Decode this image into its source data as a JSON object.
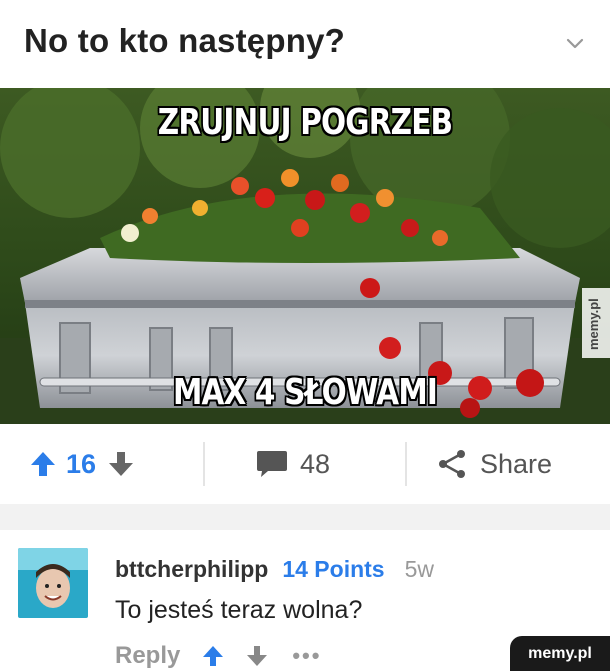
{
  "post": {
    "title": "No to kto następny?"
  },
  "image": {
    "caption_top": "ZRUJNUJ POGRZEB",
    "caption_bottom": "MAX 4 SŁOWAMI",
    "side_watermark": "memy.pl"
  },
  "actions": {
    "upvotes": "16",
    "comments": "48",
    "share_label": "Share"
  },
  "comment": {
    "username": "bttcherphilipp",
    "points": "14 Points",
    "age": "5w",
    "text": "To jesteś teraz wolna?",
    "reply_label": "Reply",
    "more": "•••"
  },
  "footer": {
    "watermark": "memy.pl"
  },
  "colors": {
    "accent": "#2b7de9",
    "muted": "#999999"
  }
}
